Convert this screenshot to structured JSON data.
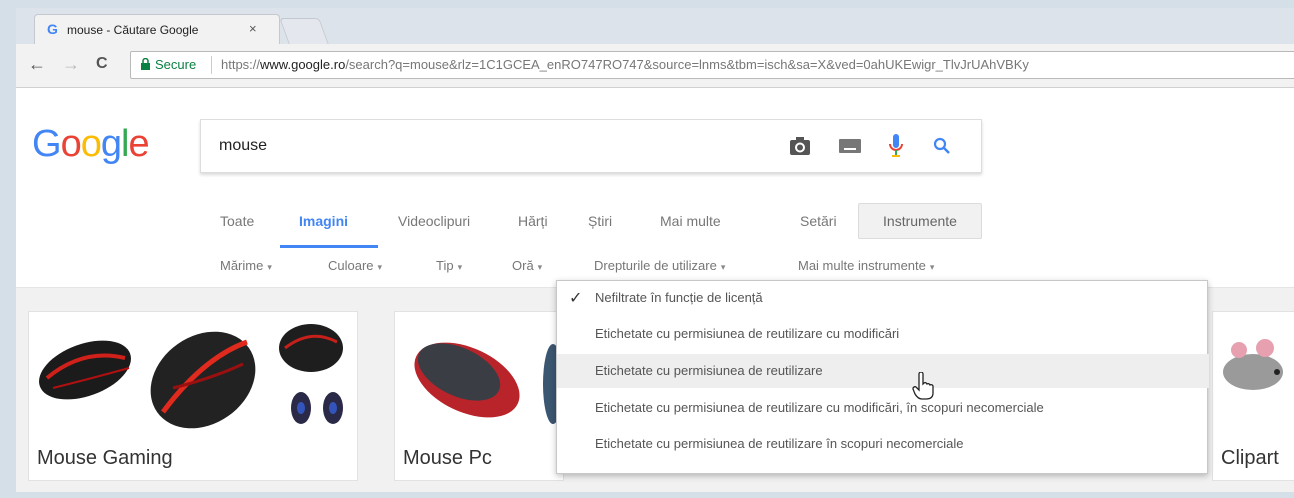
{
  "browser": {
    "tab_title": "mouse - Căutare Google",
    "tab_favicon": "G",
    "tab_close": "×",
    "secure_label": "Secure",
    "url_prefix": "https://",
    "url_domain": "www.google.ro",
    "url_rest": "/search?q=mouse&rlz=1C1GCEA_enRO747RO747&source=lnms&tbm=isch&sa=X&ved=0ahUKEwigr_TlvJrUAhVBKy",
    "back_icon": "←",
    "forward_icon": "→",
    "reload_icon": "C"
  },
  "google": {
    "logo_letters": [
      {
        "ch": "G",
        "color": "#4285f4"
      },
      {
        "ch": "o",
        "color": "#ea4335"
      },
      {
        "ch": "o",
        "color": "#fbbc05"
      },
      {
        "ch": "g",
        "color": "#4285f4"
      },
      {
        "ch": "l",
        "color": "#34a853"
      },
      {
        "ch": "e",
        "color": "#ea4335"
      }
    ],
    "query": "mouse",
    "icons": [
      "camera-icon",
      "keyboard-icon",
      "microphone-icon",
      "search-icon"
    ]
  },
  "tabs": [
    {
      "label": "Toate",
      "active": false
    },
    {
      "label": "Imagini",
      "active": true
    },
    {
      "label": "Videoclipuri",
      "active": false
    },
    {
      "label": "Hărți",
      "active": false
    },
    {
      "label": "Știri",
      "active": false
    },
    {
      "label": "Mai multe",
      "active": false
    },
    {
      "label": "Setări",
      "active": false
    }
  ],
  "tools_button": "Instrumente",
  "tools": [
    {
      "label": "Mărime",
      "caret": "▾"
    },
    {
      "label": "Culoare",
      "caret": "▾"
    },
    {
      "label": "Tip",
      "caret": "▾"
    },
    {
      "label": "Oră",
      "caret": "▾"
    },
    {
      "label": "Drepturile de utilizare",
      "caret": "▾"
    },
    {
      "label": "Mai multe instrumente",
      "caret": "▾"
    }
  ],
  "dropdown": {
    "check": "✓",
    "items": [
      {
        "label": "Nefiltrate în funcție de licență",
        "selected": true
      },
      {
        "label": "Etichetate cu permisiunea de reutilizare cu modificări",
        "selected": false
      },
      {
        "label": "Etichetate cu permisiunea de reutilizare",
        "selected": false
      },
      {
        "label": "Etichetate cu permisiunea de reutilizare cu modificări, în scopuri necomerciale",
        "selected": false
      },
      {
        "label": "Etichetate cu permisiunea de reutilizare în scopuri necomerciale",
        "selected": false
      }
    ]
  },
  "cards": [
    {
      "label": "Mouse Gaming"
    },
    {
      "label": "Mouse Pc"
    },
    {
      "label": "Clipart"
    }
  ],
  "colors": {
    "accent": "#4285f4",
    "secure": "#0b8043"
  }
}
